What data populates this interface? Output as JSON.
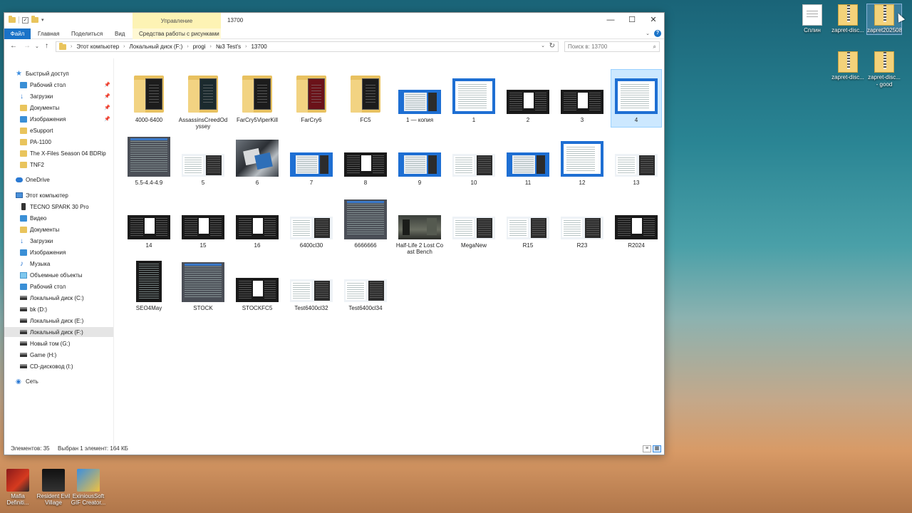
{
  "desktop": {
    "icons": [
      {
        "label": "Сплин",
        "type": "doc"
      },
      {
        "label": "zapret-disc...",
        "type": "zip"
      },
      {
        "label": "zapret202508",
        "type": "zip"
      },
      {
        "label": "zapret-disc...",
        "type": "zip"
      },
      {
        "label": "zapret-disc... - good",
        "type": "zip"
      }
    ],
    "bottom_apps": [
      {
        "label": "Mafia Definiti..."
      },
      {
        "label": "Resident Evil Village"
      },
      {
        "label": "ExiniousSoft GIF Creator..."
      }
    ]
  },
  "window": {
    "title": "13700",
    "manage_tab": "Управление",
    "ribbon_tabs": [
      "Файл",
      "Главная",
      "Поделиться",
      "Вид"
    ],
    "picture_tools_tab": "Средства работы с рисунками",
    "breadcrumb": [
      "Этот компьютер",
      "Локальный диск (F:)",
      "progi",
      "№3 Test's",
      "13700"
    ],
    "search_placeholder": "Поиск в: 13700",
    "controls": {
      "minimize": "—",
      "maximize": "☐",
      "close": "✕"
    }
  },
  "nav": {
    "items": [
      {
        "label": "Быстрый доступ",
        "icon": "star-icon",
        "indent": 0,
        "pinned": false
      },
      {
        "label": "Рабочий стол",
        "icon": "folder-blue",
        "indent": 1,
        "pinned": true
      },
      {
        "label": "Загрузки",
        "icon": "download",
        "indent": 1,
        "pinned": true
      },
      {
        "label": "Документы",
        "icon": "doc",
        "indent": 1,
        "pinned": true
      },
      {
        "label": "Изображения",
        "icon": "img",
        "indent": 1,
        "pinned": true
      },
      {
        "label": "eSupport",
        "icon": "folder",
        "indent": 1,
        "pinned": false
      },
      {
        "label": "PA-1100",
        "icon": "folder",
        "indent": 1,
        "pinned": false
      },
      {
        "label": "The X-Files Season 04 BDRip",
        "icon": "folder",
        "indent": 1,
        "pinned": false
      },
      {
        "label": "TNF2",
        "icon": "folder",
        "indent": 1,
        "pinned": false
      },
      {
        "label": "OneDrive",
        "icon": "cloud",
        "indent": 0,
        "pinned": false
      },
      {
        "label": "Этот компьютер",
        "icon": "pc",
        "indent": 0,
        "pinned": false
      },
      {
        "label": "TECNO SPARK 30 Pro",
        "icon": "phone",
        "indent": 1,
        "pinned": false
      },
      {
        "label": "Видео",
        "icon": "video",
        "indent": 1,
        "pinned": false
      },
      {
        "label": "Документы",
        "icon": "doc",
        "indent": 1,
        "pinned": false
      },
      {
        "label": "Загрузки",
        "icon": "download",
        "indent": 1,
        "pinned": false
      },
      {
        "label": "Изображения",
        "icon": "img",
        "indent": 1,
        "pinned": false
      },
      {
        "label": "Музыка",
        "icon": "music",
        "indent": 1,
        "pinned": false
      },
      {
        "label": "Объемные объекты",
        "icon": "cube",
        "indent": 1,
        "pinned": false
      },
      {
        "label": "Рабочий стол",
        "icon": "folder-blue",
        "indent": 1,
        "pinned": false
      },
      {
        "label": "Локальный диск (C:)",
        "icon": "drive",
        "indent": 1,
        "pinned": false
      },
      {
        "label": "bk (D:)",
        "icon": "drive",
        "indent": 1,
        "pinned": false
      },
      {
        "label": "Локальный диск (E:)",
        "icon": "drive",
        "indent": 1,
        "pinned": false
      },
      {
        "label": "Локальный диск (F:)",
        "icon": "drive",
        "indent": 1,
        "pinned": false,
        "selected": true
      },
      {
        "label": "Новый том (G:)",
        "icon": "drive",
        "indent": 1,
        "pinned": false
      },
      {
        "label": "Game (H:)",
        "icon": "drive",
        "indent": 1,
        "pinned": false
      },
      {
        "label": "CD-дисковод (I:)",
        "icon": "drive",
        "indent": 1,
        "pinned": false
      },
      {
        "label": "Сеть",
        "icon": "net",
        "indent": 0,
        "pinned": false
      }
    ]
  },
  "files": [
    {
      "name": "4000-6400",
      "kind": "folder",
      "paper": "dark"
    },
    {
      "name": "AssassinsCreedOdyssey",
      "kind": "folder",
      "paper": "teal"
    },
    {
      "name": "FarCry5ViperKill",
      "kind": "folder",
      "paper": "dark"
    },
    {
      "name": "FarCry6",
      "kind": "folder",
      "paper": "red"
    },
    {
      "name": "FC5",
      "kind": "folder",
      "paper": "dark"
    },
    {
      "name": "1 — копия",
      "kind": "image",
      "style": "blue-win"
    },
    {
      "name": "1",
      "kind": "image",
      "style": "blue-tall"
    },
    {
      "name": "2",
      "kind": "image",
      "style": "dark-mix"
    },
    {
      "name": "3",
      "kind": "image",
      "style": "dark-mix"
    },
    {
      "name": "4",
      "kind": "image",
      "style": "blue-tall",
      "selected": true
    },
    {
      "name": "5.5-4.4-4.9",
      "kind": "image",
      "style": "gray-tall"
    },
    {
      "name": "5",
      "kind": "image",
      "style": "light-mix"
    },
    {
      "name": "6",
      "kind": "image",
      "style": "photo"
    },
    {
      "name": "7",
      "kind": "image",
      "style": "blue-win"
    },
    {
      "name": "8",
      "kind": "image",
      "style": "dark-mix"
    },
    {
      "name": "9",
      "kind": "image",
      "style": "blue-win"
    },
    {
      "name": "10",
      "kind": "image",
      "style": "light-mix"
    },
    {
      "name": "11",
      "kind": "image",
      "style": "blue-win"
    },
    {
      "name": "12",
      "kind": "image",
      "style": "blue-tall"
    },
    {
      "name": "13",
      "kind": "image",
      "style": "light-mix"
    },
    {
      "name": "14",
      "kind": "image",
      "style": "dark-mix"
    },
    {
      "name": "15",
      "kind": "image",
      "style": "dark-mix"
    },
    {
      "name": "16",
      "kind": "image",
      "style": "dark-mix"
    },
    {
      "name": "6400cl30",
      "kind": "image",
      "style": "light-mix"
    },
    {
      "name": "6666666",
      "kind": "image",
      "style": "gray-tall"
    },
    {
      "name": "Half-Life 2 Lost Coast Bench",
      "kind": "image",
      "style": "game"
    },
    {
      "name": "MegaNew",
      "kind": "image",
      "style": "light-mix"
    },
    {
      "name": "R15",
      "kind": "image",
      "style": "light-mix"
    },
    {
      "name": "R23",
      "kind": "image",
      "style": "light-mix"
    },
    {
      "name": "R2024",
      "kind": "image",
      "style": "dark-mix"
    },
    {
      "name": "SEO4May",
      "kind": "image",
      "style": "dark-tall"
    },
    {
      "name": "STOCK",
      "kind": "image",
      "style": "gray-tall"
    },
    {
      "name": "STOCKFC5",
      "kind": "image",
      "style": "dark-mix"
    },
    {
      "name": "Test6400cl32",
      "kind": "image",
      "style": "light-mix"
    },
    {
      "name": "Test6400cl34",
      "kind": "image",
      "style": "light-mix"
    }
  ],
  "status": {
    "count": "Элементов: 35",
    "selection": "Выбран 1 элемент: 164 КБ"
  },
  "colors": {
    "accent": "#1a73c8",
    "selection": "#cce8ff",
    "manage_tab": "#fdf3b4"
  }
}
